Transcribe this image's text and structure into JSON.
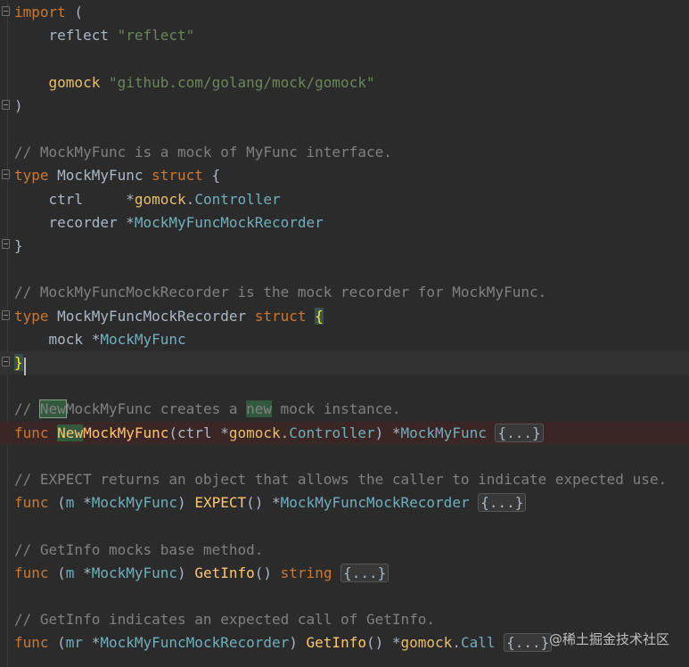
{
  "editor": {
    "lines": [
      {
        "id": "l1",
        "tokens": [
          {
            "t": "import",
            "c": "kw"
          },
          {
            "t": " (",
            "c": "plain"
          }
        ]
      },
      {
        "id": "l2",
        "tokens": [
          {
            "t": "    reflect ",
            "c": "plain"
          },
          {
            "t": "\"reflect\"",
            "c": "str"
          }
        ]
      },
      {
        "id": "l3",
        "tokens": []
      },
      {
        "id": "l4",
        "tokens": [
          {
            "t": "    gomock ",
            "c": "pkg"
          },
          {
            "t": "\"github.com/golang/mock/gomock\"",
            "c": "str"
          }
        ]
      },
      {
        "id": "l5",
        "tokens": [
          {
            "t": ")",
            "c": "plain"
          }
        ]
      },
      {
        "id": "l6",
        "tokens": []
      },
      {
        "id": "l7",
        "tokens": [
          {
            "t": "// MockMyFunc is a mock of MyFunc interface.",
            "c": "com"
          }
        ]
      },
      {
        "id": "l8",
        "tokens": [
          {
            "t": "type",
            "c": "kw"
          },
          {
            "t": " MockMyFunc ",
            "c": "plain"
          },
          {
            "t": "struct",
            "c": "kw"
          },
          {
            "t": " {",
            "c": "plain"
          }
        ]
      },
      {
        "id": "l9",
        "tokens": [
          {
            "t": "    ctrl     ",
            "c": "plain"
          },
          {
            "t": "*",
            "c": "plain"
          },
          {
            "t": "gomock",
            "c": "pkg"
          },
          {
            "t": ".",
            "c": "plain"
          },
          {
            "t": "Controller",
            "c": "typ"
          }
        ]
      },
      {
        "id": "l10",
        "tokens": [
          {
            "t": "    recorder ",
            "c": "plain"
          },
          {
            "t": "*",
            "c": "plain"
          },
          {
            "t": "MockMyFuncMockRecorder",
            "c": "typ"
          }
        ]
      },
      {
        "id": "l11",
        "tokens": [
          {
            "t": "}",
            "c": "plain"
          }
        ]
      },
      {
        "id": "l12",
        "tokens": []
      },
      {
        "id": "l13",
        "tokens": [
          {
            "t": "// MockMyFuncMockRecorder is the mock recorder for MockMyFunc.",
            "c": "com"
          }
        ]
      },
      {
        "id": "l14",
        "tokens": [
          {
            "t": "type",
            "c": "kw"
          },
          {
            "t": " MockMyFuncMockRecorder ",
            "c": "plain"
          },
          {
            "t": "struct",
            "c": "kw"
          },
          {
            "t": " ",
            "c": "plain"
          },
          {
            "t": "{",
            "c": "brace-match"
          }
        ]
      },
      {
        "id": "l15",
        "tokens": [
          {
            "t": "    mock ",
            "c": "plain"
          },
          {
            "t": "*",
            "c": "plain"
          },
          {
            "t": "MockMyFunc",
            "c": "typ"
          }
        ]
      },
      {
        "id": "l16",
        "tokens": [
          {
            "t": "}",
            "c": "brace-match"
          }
        ]
      },
      {
        "id": "l17",
        "tokens": []
      },
      {
        "id": "l18",
        "tokens": [
          {
            "t": "// ",
            "c": "com"
          },
          {
            "t": "New",
            "c": "com hl-box"
          },
          {
            "t": "MockMyFunc creates a ",
            "c": "com"
          },
          {
            "t": "new",
            "c": "com hl-green"
          },
          {
            "t": " mock instance.",
            "c": "com"
          }
        ]
      },
      {
        "id": "l19",
        "tokens": [
          {
            "t": "func",
            "c": "kw"
          },
          {
            "t": " ",
            "c": "plain"
          },
          {
            "t": "New",
            "c": "fn hl-green"
          },
          {
            "t": "MockMyFunc",
            "c": "fn"
          },
          {
            "t": "(ctrl ",
            "c": "plain"
          },
          {
            "t": "*",
            "c": "plain"
          },
          {
            "t": "gomock",
            "c": "pkg"
          },
          {
            "t": ".",
            "c": "plain"
          },
          {
            "t": "Controller",
            "c": "typ"
          },
          {
            "t": ") ",
            "c": "plain"
          },
          {
            "t": "*",
            "c": "plain"
          },
          {
            "t": "MockMyFunc",
            "c": "typ"
          },
          {
            "t": " ",
            "c": "plain"
          },
          {
            "t": "{...}",
            "c": "fold-pill"
          }
        ]
      },
      {
        "id": "l20",
        "tokens": []
      },
      {
        "id": "l21",
        "tokens": [
          {
            "t": "// EXPECT returns an object that allows the caller to indicate expected use.",
            "c": "com"
          }
        ]
      },
      {
        "id": "l22",
        "tokens": [
          {
            "t": "func",
            "c": "kw"
          },
          {
            "t": " (",
            "c": "plain"
          },
          {
            "t": "m",
            "c": "typ"
          },
          {
            "t": " ",
            "c": "plain"
          },
          {
            "t": "*",
            "c": "plain"
          },
          {
            "t": "MockMyFunc",
            "c": "typ"
          },
          {
            "t": ") ",
            "c": "plain"
          },
          {
            "t": "EXPECT",
            "c": "fn"
          },
          {
            "t": "() ",
            "c": "plain"
          },
          {
            "t": "*",
            "c": "plain"
          },
          {
            "t": "MockMyFuncMockRecorder",
            "c": "typ"
          },
          {
            "t": " ",
            "c": "plain"
          },
          {
            "t": "{...}",
            "c": "fold-pill"
          }
        ]
      },
      {
        "id": "l23",
        "tokens": []
      },
      {
        "id": "l24",
        "tokens": [
          {
            "t": "// GetInfo mocks base method.",
            "c": "com"
          }
        ]
      },
      {
        "id": "l25",
        "tokens": [
          {
            "t": "func",
            "c": "kw"
          },
          {
            "t": " (",
            "c": "plain"
          },
          {
            "t": "m",
            "c": "typ"
          },
          {
            "t": " ",
            "c": "plain"
          },
          {
            "t": "*",
            "c": "plain"
          },
          {
            "t": "MockMyFunc",
            "c": "typ"
          },
          {
            "t": ") ",
            "c": "plain"
          },
          {
            "t": "GetInfo",
            "c": "fn"
          },
          {
            "t": "() ",
            "c": "plain"
          },
          {
            "t": "string",
            "c": "kw"
          },
          {
            "t": " ",
            "c": "plain"
          },
          {
            "t": "{...}",
            "c": "fold-pill"
          }
        ]
      },
      {
        "id": "l26",
        "tokens": []
      },
      {
        "id": "l27",
        "tokens": [
          {
            "t": "// GetInfo indicates an expected call of GetInfo.",
            "c": "com"
          }
        ]
      },
      {
        "id": "l28",
        "tokens": [
          {
            "t": "func",
            "c": "kw"
          },
          {
            "t": " (",
            "c": "plain"
          },
          {
            "t": "mr",
            "c": "typ"
          },
          {
            "t": " ",
            "c": "plain"
          },
          {
            "t": "*",
            "c": "plain"
          },
          {
            "t": "MockMyFuncMockRecorder",
            "c": "typ"
          },
          {
            "t": ") ",
            "c": "plain"
          },
          {
            "t": "GetInfo",
            "c": "fn"
          },
          {
            "t": "() ",
            "c": "plain"
          },
          {
            "t": "*",
            "c": "plain"
          },
          {
            "t": "gomock",
            "c": "pkg"
          },
          {
            "t": ".",
            "c": "plain"
          },
          {
            "t": "Call",
            "c": "typ"
          },
          {
            "t": " ",
            "c": "plain"
          },
          {
            "t": "{...}",
            "c": "fold-pill"
          }
        ]
      }
    ]
  },
  "watermark": {
    "text": "@稀土掘金技术社区"
  }
}
